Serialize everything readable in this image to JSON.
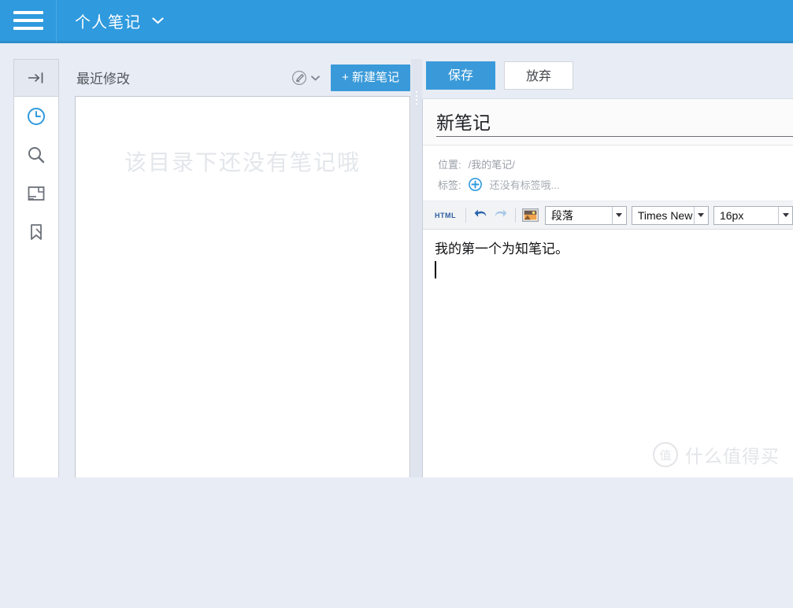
{
  "topbar": {
    "menu_icon": "hamburger-menu-icon",
    "title": "个人笔记",
    "caret": "⌄",
    "bg_color": "#2f9ade"
  },
  "sidebar": {
    "collapse_icon": "collapse-panel-icon",
    "items": [
      {
        "icon": "clock-icon",
        "name": "recent",
        "active": true
      },
      {
        "icon": "search-icon",
        "name": "search",
        "active": false
      },
      {
        "icon": "notebook-icon",
        "name": "notebooks",
        "active": false
      },
      {
        "icon": "bookmark-icon",
        "name": "tags",
        "active": false
      }
    ]
  },
  "list_panel": {
    "title": "最近修改",
    "edit_menu_icon": "pencil-icon",
    "edit_menu_caret": "⌄",
    "new_note_label": "+ 新建笔记",
    "empty_message": "该目录下还没有笔记哦",
    "accent_color": "#3a9ad9"
  },
  "editor": {
    "save_label": "保存",
    "discard_label": "放弃",
    "note_title": "新笔记",
    "meta": {
      "location_label": "位置:",
      "location_value": "/我的笔记/",
      "tags_label": "标签:",
      "tag_add_icon": "plus-circle-icon",
      "tags_placeholder": "还没有标签哦..."
    },
    "toolbar": {
      "html_label": "HTML",
      "undo_icon": "undo-icon",
      "redo_icon": "redo-icon",
      "image_icon": "insert-image-icon",
      "paragraph_value": "段落",
      "font_value": "Times New Roman",
      "size_value": "16px"
    },
    "content": {
      "line1": "我的第一个为知笔记。"
    }
  },
  "watermark": {
    "mark": "值",
    "text": "什么值得买"
  }
}
